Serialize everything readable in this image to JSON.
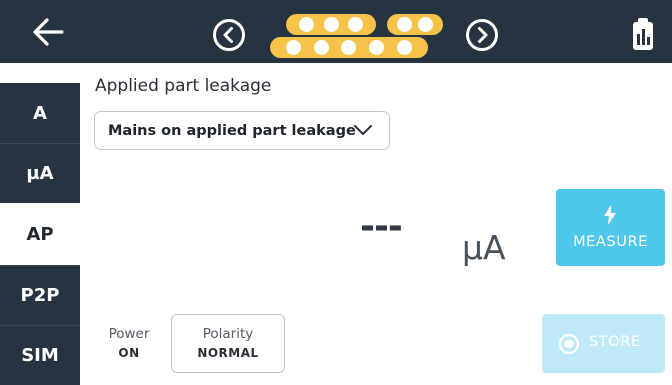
{
  "header": {
    "back_icon": "arrow-left-icon",
    "prev_icon": "chevron-left-circle-icon",
    "next_icon": "chevron-right-circle-icon",
    "report_icon": "clipboard-chart-icon",
    "pin_color": "#f6c34a",
    "bar_color": "#263340"
  },
  "sidebar": {
    "items": [
      {
        "label": "A",
        "active": false
      },
      {
        "label": "µA",
        "active": false
      },
      {
        "label": "AP",
        "active": true
      },
      {
        "label": "P2P",
        "active": false
      },
      {
        "label": "SIM",
        "active": false
      }
    ]
  },
  "main": {
    "title": "Applied part leakage",
    "dropdown_value": "Mains on applied part leakage",
    "reading_value": "---",
    "reading_unit": "µA"
  },
  "measure": {
    "label": "MEASURE",
    "icon": "lightning-bolt-icon",
    "color": "#4fc6ec"
  },
  "power": {
    "label": "Power",
    "value": "ON"
  },
  "polarity": {
    "label": "Polarity",
    "value": "NORMAL"
  },
  "store": {
    "label": "STORE",
    "icon": "record-circle-icon",
    "color": "#bfe9f7"
  }
}
